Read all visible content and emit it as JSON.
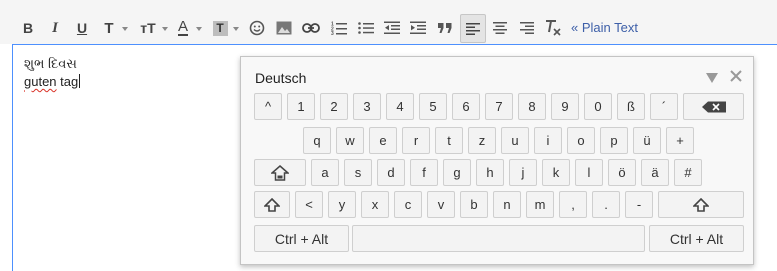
{
  "toolbar": {
    "bold_label": "B",
    "italic_label": "I",
    "underline_label": "U",
    "font_label": "T",
    "size_label": "тT",
    "color_label": "A",
    "background_label": "T",
    "plain_text_label": "« Plain Text"
  },
  "editor": {
    "line1": "શુભ દિવસ",
    "line2": "guten tag"
  },
  "keyboard": {
    "title": "Deutsch",
    "rows": [
      [
        "^",
        "1",
        "2",
        "3",
        "4",
        "5",
        "6",
        "7",
        "8",
        "9",
        "0",
        "ß",
        "´"
      ],
      [
        "q",
        "w",
        "e",
        "r",
        "t",
        "z",
        "u",
        "i",
        "o",
        "p",
        "ü",
        "+"
      ],
      [
        "a",
        "s",
        "d",
        "f",
        "g",
        "h",
        "j",
        "k",
        "l",
        "ö",
        "ä",
        "#"
      ],
      [
        "<",
        "y",
        "x",
        "c",
        "v",
        "b",
        "n",
        "m",
        ",",
        ".",
        "-"
      ]
    ],
    "ctrl_alt_left": "Ctrl + Alt",
    "ctrl_alt_right": "Ctrl + Alt"
  },
  "colors": {
    "editor_border": "#4d90fe",
    "link": "#3d5fa8",
    "spell_underline": "#d93025"
  }
}
